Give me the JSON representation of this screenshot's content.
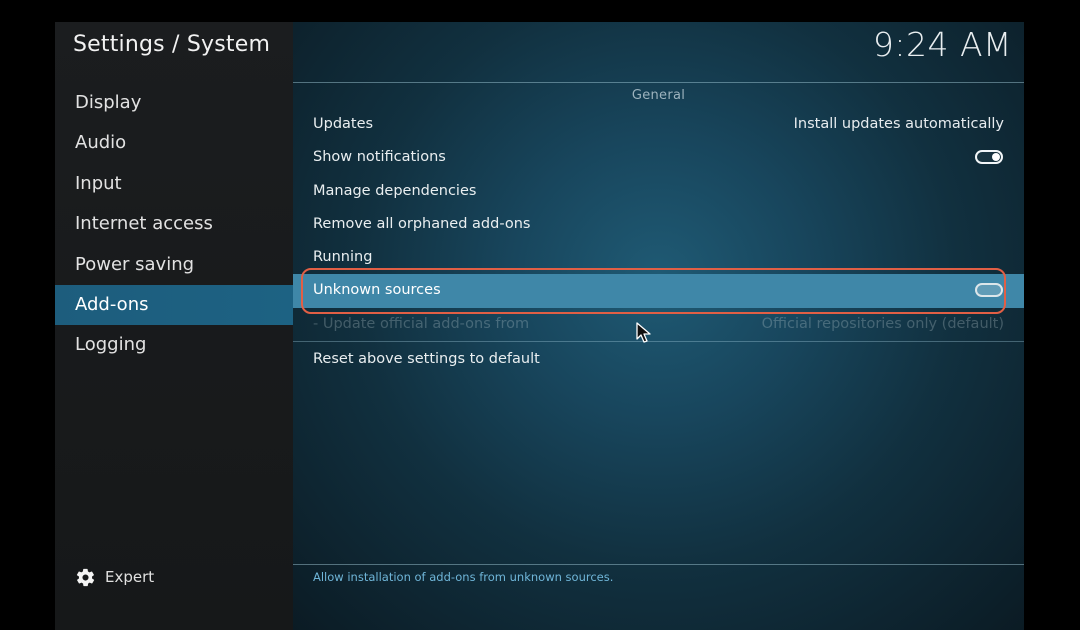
{
  "window": {
    "breadcrumb": "Settings / System",
    "clock": "9:24 AM"
  },
  "sidebar": {
    "items": [
      {
        "label": "Display",
        "active": false
      },
      {
        "label": "Audio",
        "active": false
      },
      {
        "label": "Input",
        "active": false
      },
      {
        "label": "Internet access",
        "active": false
      },
      {
        "label": "Power saving",
        "active": false
      },
      {
        "label": "Add-ons",
        "active": true
      },
      {
        "label": "Logging",
        "active": false
      }
    ],
    "expert_label": "Expert",
    "expert_icon": "gear-icon"
  },
  "main": {
    "section_title": "General",
    "settings": [
      {
        "label": "Updates",
        "value": "Install updates automatically"
      },
      {
        "label": "Show notifications",
        "toggle": "on"
      },
      {
        "label": "Manage dependencies"
      },
      {
        "label": "Remove all orphaned add-ons"
      },
      {
        "label": "Running"
      },
      {
        "label": "Unknown sources",
        "toggle": "off",
        "selected": true
      },
      {
        "label": "- Update official add-ons from",
        "value": "Official repositories only (default)",
        "disabled": true
      }
    ],
    "reset_label": "Reset above settings to default",
    "description": "Allow installation of add-ons from unknown sources."
  },
  "colors": {
    "highlight_outline": "#e15f45",
    "selected_row": "#3f87a8",
    "active_sidebar": "#1d6283"
  }
}
